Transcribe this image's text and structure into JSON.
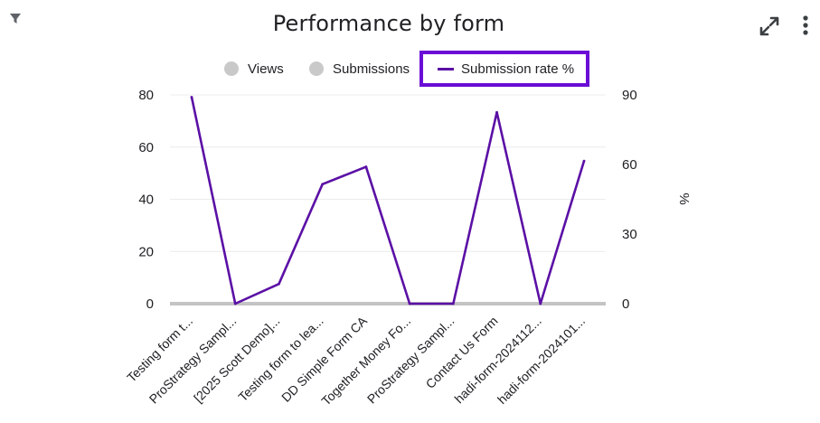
{
  "card": {
    "title": "Performance by form",
    "icons": {
      "filter": "filter-icon",
      "expand": "expand-icon",
      "more": "more-vert-icon"
    }
  },
  "legend": {
    "items": [
      {
        "label": "Views",
        "style": "dot",
        "color": "#c9c9c9"
      },
      {
        "label": "Submissions",
        "style": "dot",
        "color": "#c9c9c9"
      },
      {
        "label": "Submission rate %",
        "style": "line",
        "color": "#5b10a5",
        "highlighted": true
      }
    ]
  },
  "chart_data": {
    "type": "line",
    "title": "Performance by form",
    "categories": [
      "Testing form t...",
      "ProStrategy Sampl...",
      "[2025 Scott Demo]...",
      "Testing form to lea...",
      "DD Simple Form CA",
      "Together Money Fo...",
      "ProStrategy Sampl...",
      "Contact Us Form",
      "hadi-form-2024112...",
      "hadi-form-2024101..."
    ],
    "left_axis": {
      "ticks": [
        0,
        20,
        40,
        60,
        80
      ],
      "ylim": [
        0,
        80
      ]
    },
    "right_axis": {
      "label": "%",
      "ticks": [
        0,
        30,
        60,
        90
      ],
      "ylim": [
        0,
        90
      ]
    },
    "series": [
      {
        "name": "Submission rate %",
        "axis": "right",
        "color": "#5b10a5",
        "values": [
          89,
          0,
          8.5,
          51.5,
          59,
          0,
          0,
          82.5,
          0,
          61.5
        ]
      }
    ],
    "grid": true,
    "legend_position": "top"
  }
}
